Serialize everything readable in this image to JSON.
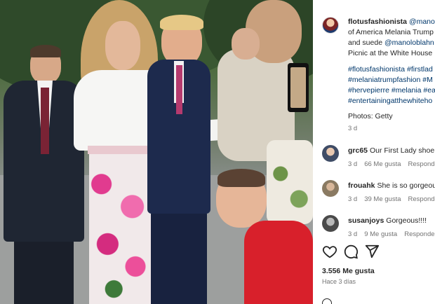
{
  "caption": {
    "username": "flotusfashionista",
    "mention_1": "@manolo",
    "line_2": "of America Melania Trump",
    "line_3_prefix": "and suede ",
    "mention_2": "@manoloblahn",
    "line_4": "Picnic at the White House",
    "hashtags": [
      "#flotusfashionista #firstlad",
      "#melaniatrumpfashion #M",
      "#hervepierre #melania #ea",
      "#entertainingatthewhiteho"
    ],
    "photos_credit": "Photos: Getty",
    "time": "3 d"
  },
  "comments": [
    {
      "username": "grc65",
      "text": "Our First Lady shoe g",
      "time": "3 d",
      "likes": "66 Me gusta",
      "reply": "Responder"
    },
    {
      "username": "frouahk",
      "text": "She is so gorgeou",
      "time": "3 d",
      "likes": "39 Me gusta",
      "reply": "Responder"
    },
    {
      "username": "susanjoys",
      "text": "Gorgeous!!!!",
      "time": "3 d",
      "likes": "9 Me gusta",
      "reply": "Responder"
    }
  ],
  "footer": {
    "likes": "3.556 Me gusta",
    "ago": "Hace 3 días"
  },
  "icons": [
    "heart-icon",
    "comment-icon",
    "share-icon"
  ]
}
